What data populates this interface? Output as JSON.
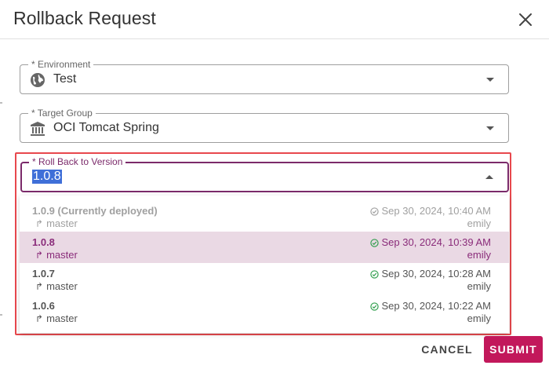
{
  "dialog": {
    "title": "Rollback Request",
    "close_icon": "close-icon"
  },
  "environment": {
    "legend": "* Environment",
    "value": "Test",
    "icon": "globe-icon"
  },
  "target_group": {
    "legend": "* Target Group",
    "value": "OCI Tomcat Spring",
    "icon": "building-icon"
  },
  "version": {
    "legend": "* Roll Back to Version",
    "value": "1.0.8"
  },
  "options": [
    {
      "version": "1.0.9 (Currently deployed)",
      "branch": "master",
      "date": "Sep 30, 2024, 10:40 AM",
      "user": "emily",
      "state": "disabled"
    },
    {
      "version": "1.0.8",
      "branch": "master",
      "date": "Sep 30, 2024, 10:39 AM",
      "user": "emily",
      "state": "selected"
    },
    {
      "version": "1.0.7",
      "branch": "master",
      "date": "Sep 30, 2024, 10:28 AM",
      "user": "emily",
      "state": "normal"
    },
    {
      "version": "1.0.6",
      "branch": "master",
      "date": "Sep 30, 2024, 10:22 AM",
      "user": "emily",
      "state": "normal"
    }
  ],
  "actions": {
    "cancel": "CANCEL",
    "submit": "SUBMIT"
  },
  "colors": {
    "accent": "#c2185b",
    "focus": "#7b2a6a",
    "selected_bg": "#ead9e4",
    "success": "#2e9d4b",
    "annotation": "#e8484d"
  }
}
